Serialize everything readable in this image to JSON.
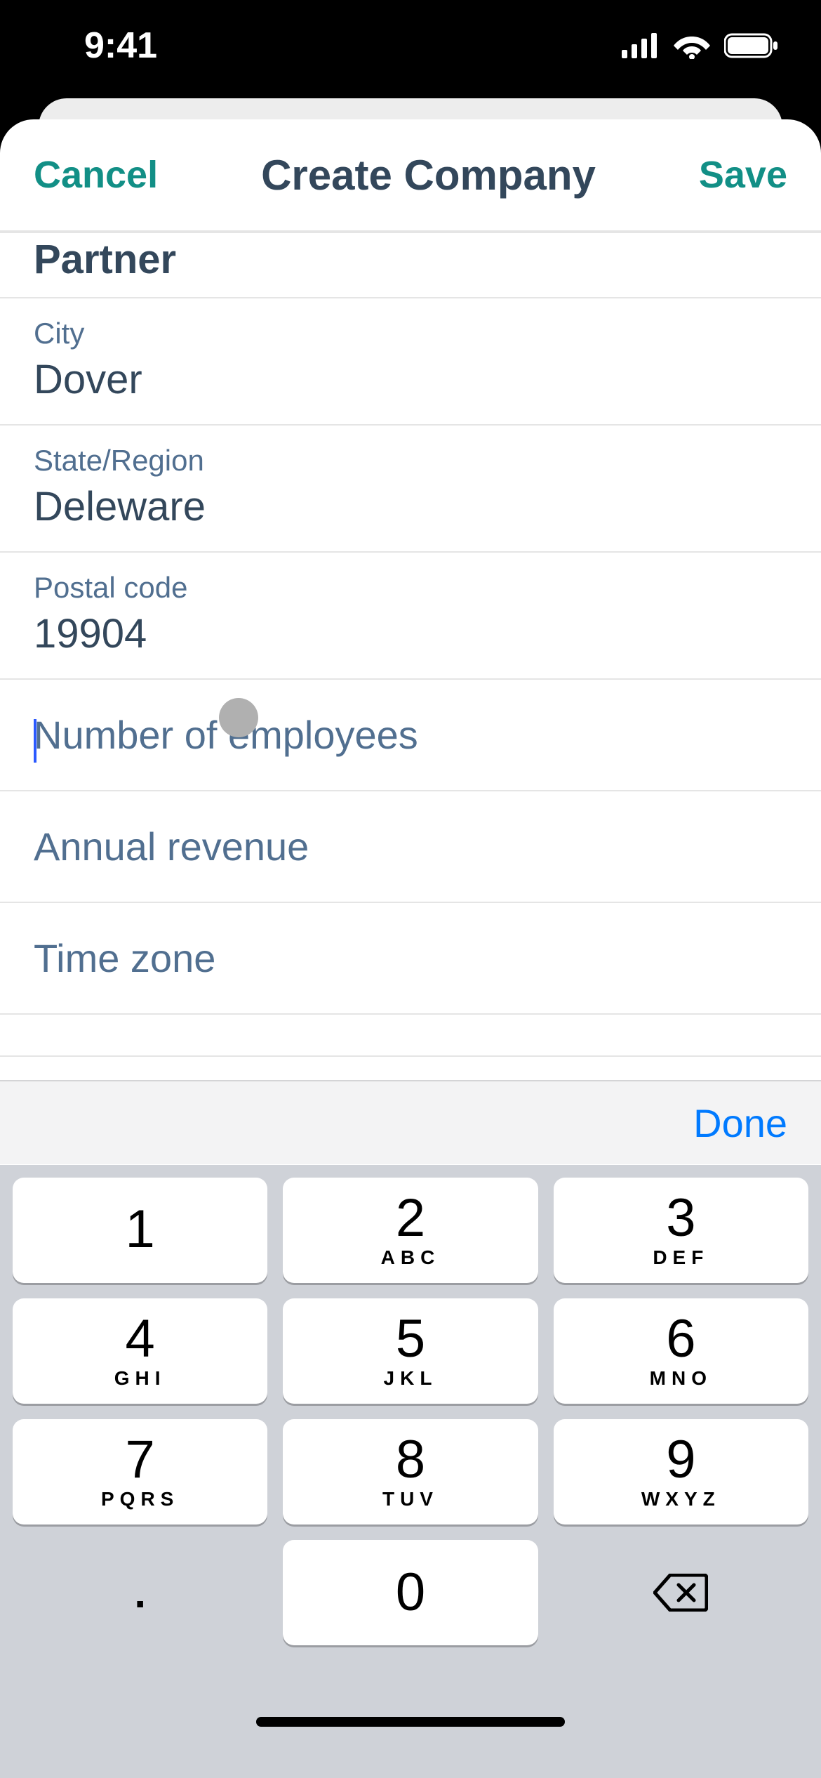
{
  "status": {
    "time": "9:41"
  },
  "nav": {
    "cancel": "Cancel",
    "title": "Create Company",
    "save": "Save"
  },
  "form": {
    "partial_value": "Partner",
    "fields": [
      {
        "label": "City",
        "value": "Dover"
      },
      {
        "label": "State/Region",
        "value": "Deleware"
      },
      {
        "label": "Postal code",
        "value": "19904"
      }
    ],
    "empty_fields": [
      {
        "placeholder": "Number of employees",
        "active": true
      },
      {
        "placeholder": "Annual revenue",
        "active": false
      },
      {
        "placeholder": "Time zone",
        "active": false
      }
    ]
  },
  "keyboard": {
    "done": "Done",
    "keys": [
      {
        "num": "1",
        "sub": ""
      },
      {
        "num": "2",
        "sub": "ABC"
      },
      {
        "num": "3",
        "sub": "DEF"
      },
      {
        "num": "4",
        "sub": "GHI"
      },
      {
        "num": "5",
        "sub": "JKL"
      },
      {
        "num": "6",
        "sub": "MNO"
      },
      {
        "num": "7",
        "sub": "PQRS"
      },
      {
        "num": "8",
        "sub": "TUV"
      },
      {
        "num": "9",
        "sub": "WXYZ"
      }
    ],
    "period": ".",
    "zero": "0"
  }
}
